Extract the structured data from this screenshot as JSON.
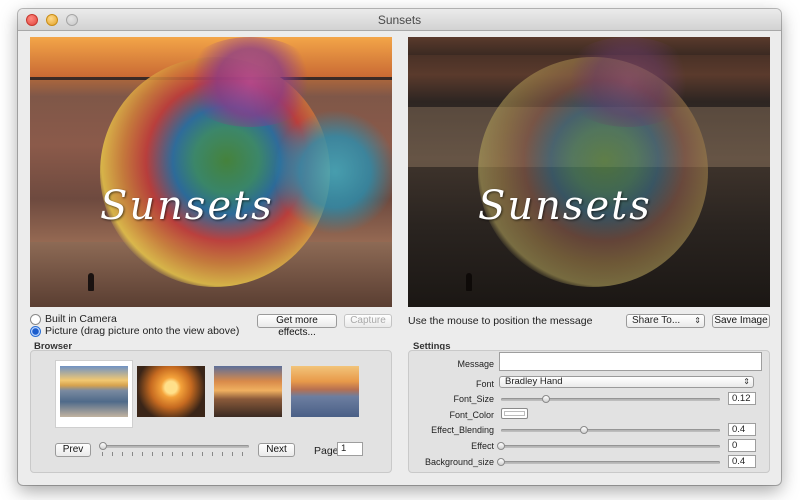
{
  "window": {
    "title": "Sunsets"
  },
  "preview": {
    "overlay_text": "Sunsets"
  },
  "camera": {
    "option_builtin": "Built in Camera",
    "option_picture": "Picture (drag picture onto the view above)",
    "selected": "picture"
  },
  "toolbar": {
    "more_effects_label": "Get more effects...",
    "capture_label": "Capture",
    "instruction": "Use the mouse to position the message",
    "share_label": "Share To...",
    "save_label": "Save Image"
  },
  "browser": {
    "title": "Browser",
    "prev_label": "Prev",
    "next_label": "Next",
    "page_label": "Page:",
    "page_value": "1",
    "thumbnail_count": 4,
    "selected_index": 0
  },
  "settings": {
    "title": "Settings",
    "message_label": "Message",
    "message_value": "",
    "font_label": "Font",
    "font_value": "Bradley Hand",
    "font_size_label": "Font_Size",
    "font_size_value": "0.12",
    "font_color_label": "Font_Color",
    "font_color": "#ffffff",
    "effect_blending_label": "Effect_Blending",
    "effect_blending_value": "0.4",
    "effect_label": "Effect",
    "effect_value": "0",
    "background_size_label": "Background_size",
    "background_size_value": "0.4"
  }
}
